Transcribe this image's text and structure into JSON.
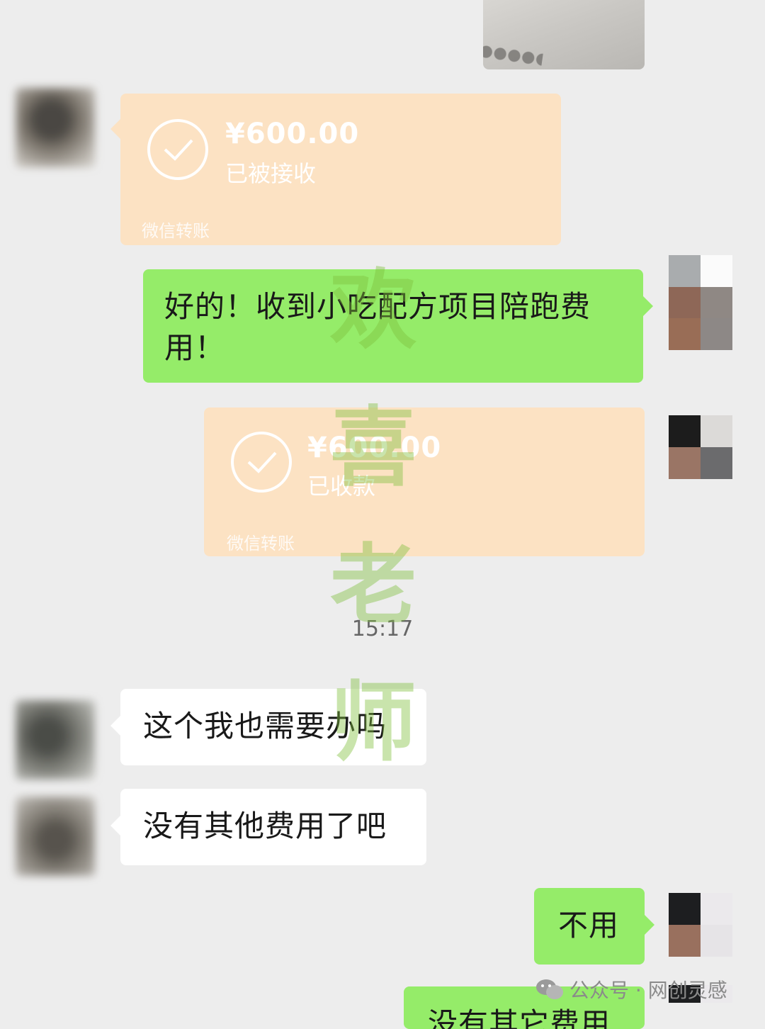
{
  "messages": [
    {
      "sender": "other",
      "type": "transfer",
      "amount": "¥600.00",
      "status": "已被接收",
      "source": "微信转账"
    },
    {
      "sender": "self",
      "type": "text",
      "text": "好的！收到小吃配方项目陪跑费用！"
    },
    {
      "sender": "self",
      "type": "transfer",
      "amount": "¥600.00",
      "status": "已收款",
      "source": "微信转账"
    },
    {
      "sender": "other",
      "type": "text",
      "text": "这个我也需要办吗"
    },
    {
      "sender": "other",
      "type": "text",
      "text": "没有其他费用了吧"
    },
    {
      "sender": "self",
      "type": "text",
      "text": "不用"
    },
    {
      "sender": "self",
      "type": "text",
      "text": "没有其它费用"
    }
  ],
  "timestamp": "15:17",
  "watermark": {
    "chars": [
      "欢",
      "喜",
      "老",
      "师"
    ]
  },
  "footer": {
    "label": "公众号 · 网创灵感",
    "icon": "wechat-icon"
  },
  "colors": {
    "background": "#ededed",
    "self_bubble": "#95ec69",
    "other_bubble": "#ffffff",
    "transfer_card": "#fce2c3"
  }
}
